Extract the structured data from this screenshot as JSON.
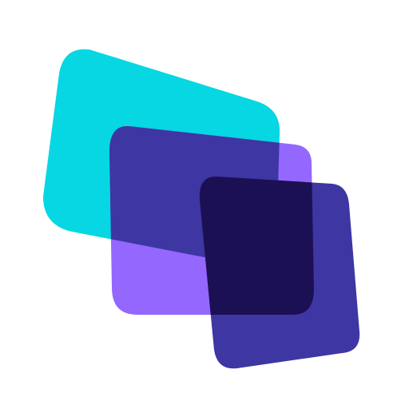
{
  "logo": {
    "icon_name": "stacked-windows-logo-icon",
    "background": "#ffffff",
    "colors": {
      "back_card": "#06D7E2",
      "middle_card": "#9467FF",
      "middle_over_back": "#3E36A3",
      "front_card": "#3E36A3",
      "front_over_middle": "#1C1054"
    }
  }
}
